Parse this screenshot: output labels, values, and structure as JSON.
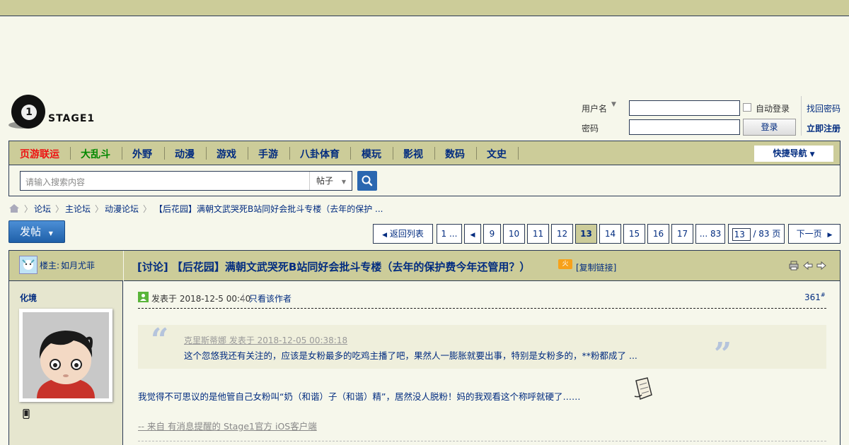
{
  "logo": {
    "text": "STAGE1",
    "mark": "1"
  },
  "login": {
    "username_label": "用户名",
    "password_label": "密码",
    "auto_login": "自动登录",
    "login_button": "登录",
    "forgot": "找回密码",
    "register": "立即注册"
  },
  "nav": {
    "items": [
      "页游联运",
      "大乱斗",
      "外野",
      "动漫",
      "游戏",
      "手游",
      "八卦体育",
      "模玩",
      "影视",
      "数码",
      "文史"
    ],
    "quick_nav": "快捷导航"
  },
  "search": {
    "placeholder": "请输入搜索内容",
    "type": "帖子"
  },
  "breadcrumb": [
    "论坛",
    "主论坛",
    "动漫论坛",
    "【后花园】满朝文武哭死B站同好会批斗专楼（去年的保护 ..."
  ],
  "post_button": "发帖",
  "pager": {
    "back": "返回列表",
    "first": "1 ...",
    "pages": [
      "9",
      "10",
      "11",
      "12",
      "13",
      "14",
      "15",
      "16",
      "17"
    ],
    "current": "13",
    "last": "... 83",
    "input_value": "13",
    "total": "/ 83 页",
    "next": "下一页"
  },
  "thread": {
    "owner_prefix": "楼主:",
    "owner": "如月尤菲",
    "title": "[讨论] 【后花园】满朝文武哭死B站同好会批斗专楼（去年的保护费今年还管用？）",
    "badge": "火",
    "copy_link": "[复制链接]"
  },
  "post": {
    "author": "化境",
    "posted_at": "发表于 2018-12-5 00:40",
    "only_author": "只看该作者",
    "floor": "361",
    "floor_sup": "#",
    "quote_author": "克里斯蒂娜 发表于 2018-12-05 00:38:18",
    "quote_text": "这个忽悠我还有关注的，应该是女粉最多的吃鸡主播了吧，果然人一膨胀就要出事，特别是女粉多的，**粉都成了 ...",
    "body": "我觉得不可思议的是他管自己女粉叫“奶（和谐）子（和谐）精”，居然没人脱粉！妈的我观看这个称呼就硬了……",
    "signature": "-- 来自 有消息提醒的 Stage1官方 iOS客户端"
  },
  "colors": {
    "nav_bg": "#cccc99",
    "link": "#022c80",
    "accent_red": "#e11",
    "accent_green": "#080",
    "post_button": "#2a67b0"
  }
}
